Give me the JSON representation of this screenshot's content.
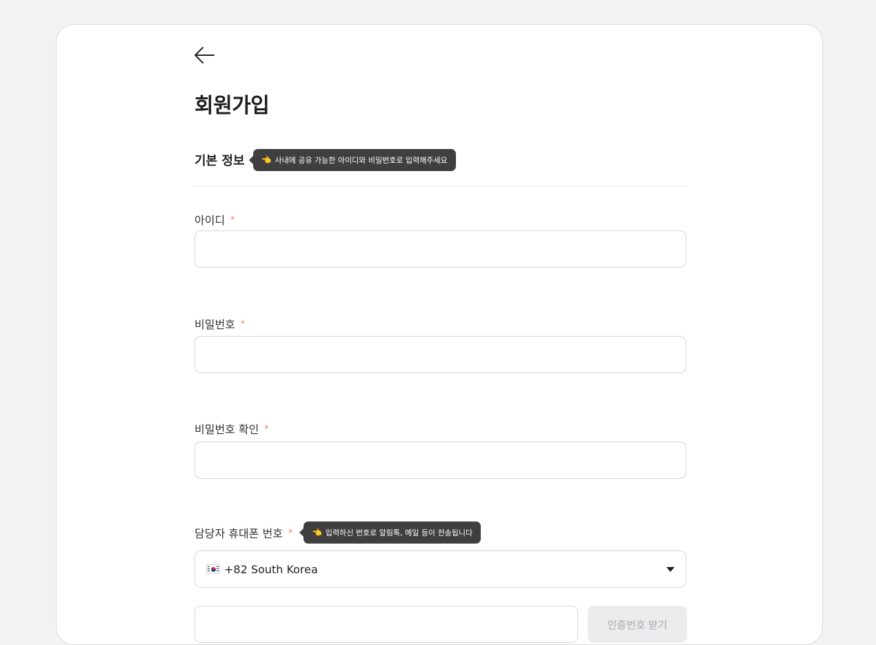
{
  "page": {
    "title": "회원가입",
    "back_icon": "arrow-left-icon"
  },
  "section": {
    "title": "기본 정보",
    "tooltip_pointer": "👈",
    "tooltip": "사내에 공유 가능한 아이디와 비밀번호로 입력해주세요"
  },
  "fields": {
    "id": {
      "label": "아이디",
      "required_mark": "*",
      "value": "",
      "placeholder": ""
    },
    "password": {
      "label": "비밀번호",
      "required_mark": "*",
      "value": "",
      "placeholder": ""
    },
    "password_confirm": {
      "label": "비밀번호 확인",
      "required_mark": "*",
      "value": "",
      "placeholder": ""
    },
    "phone": {
      "label": "담당자 휴대폰 번호",
      "required_mark": "*",
      "tooltip_pointer": "👈",
      "tooltip": "입력하신 번호로 알림톡, 메일 등이 전송됩니다",
      "country_flag": "south-korea-flag-icon",
      "country_selected": "+82 South Korea",
      "number_value": "",
      "verify_button": "인증번호 받기"
    }
  },
  "colors": {
    "required": "#ef7d52",
    "tooltip_bg": "#3f3f3f",
    "border": "#d6d6d9",
    "background": "#f2f2f3"
  }
}
